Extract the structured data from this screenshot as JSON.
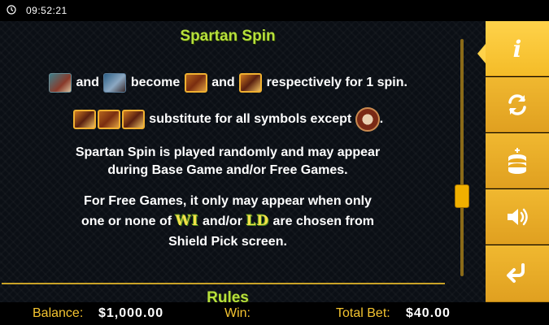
{
  "status": {
    "time": "09:52:21"
  },
  "panel": {
    "title": "Spartan Spin",
    "line1": {
      "and1": "and",
      "become": "become",
      "and2": "and",
      "tail": "respectively for 1 spin."
    },
    "line2": {
      "text": "substitute for all symbols except",
      "tail": "."
    },
    "para1": [
      "Spartan Spin is played randomly and may appear",
      "during Base Game and/or Free Games."
    ],
    "para2": {
      "line1": "For Free Games, it only may appear when only",
      "pre": "one or none of",
      "wi": "WI",
      "mid": "and/or",
      "ld": "LD",
      "post": "are chosen from",
      "line3": "Shield Pick screen."
    },
    "next_title": "Rules"
  },
  "sidebar": {
    "items": [
      {
        "icon": "info-icon",
        "active": true
      },
      {
        "icon": "autoplay-icon",
        "active": false
      },
      {
        "icon": "coin-stack-icon",
        "active": false
      },
      {
        "icon": "speaker-icon",
        "active": false
      },
      {
        "icon": "return-icon",
        "active": false
      }
    ]
  },
  "footer": {
    "balance_label": "Balance:",
    "balance_value": "$1,000.00",
    "win_label": "Win:",
    "win_value": "",
    "total_bet_label": "Total Bet:",
    "total_bet_value": "$40.00"
  },
  "colors": {
    "accent": "#f0b830",
    "title": "#b7e03c",
    "label": "#f4c430"
  }
}
